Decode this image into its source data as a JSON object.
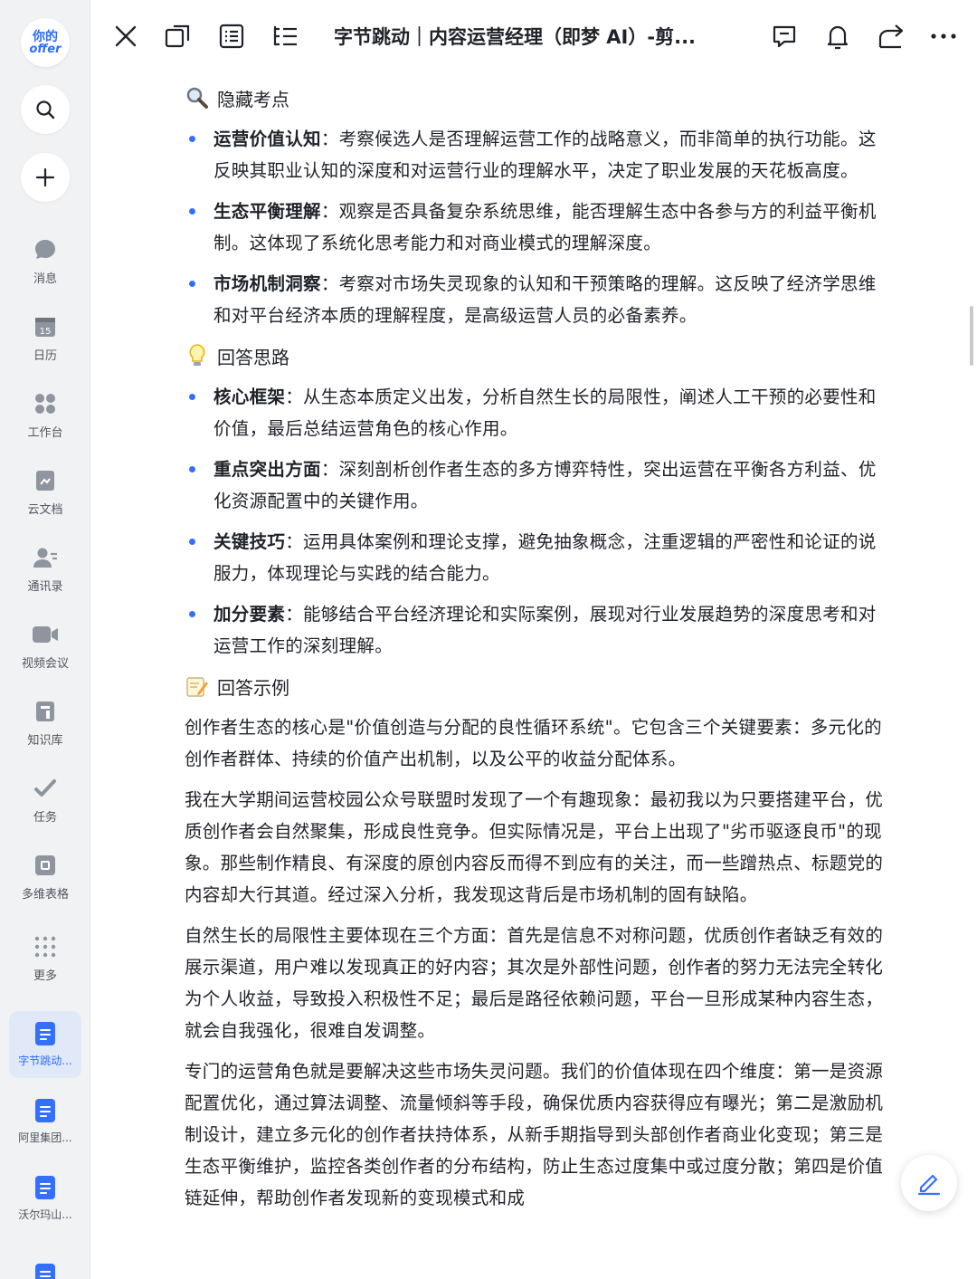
{
  "sidebar": {
    "logo_line1": "你的",
    "logo_line2": "offer",
    "search_icon": "search-icon",
    "add_icon": "plus-icon",
    "nav": [
      {
        "label": "消息",
        "icon": "chat-bubble-icon"
      },
      {
        "label": "日历",
        "icon": "calendar-icon",
        "day": "15"
      },
      {
        "label": "工作台",
        "icon": "apps-grid-icon"
      },
      {
        "label": "云文档",
        "icon": "cloud-doc-icon"
      },
      {
        "label": "通讯录",
        "icon": "contacts-icon"
      },
      {
        "label": "视频会议",
        "icon": "video-camera-icon"
      },
      {
        "label": "知识库",
        "icon": "knowledge-base-icon"
      },
      {
        "label": "任务",
        "icon": "task-check-icon"
      },
      {
        "label": "多维表格",
        "icon": "base-table-icon"
      },
      {
        "label": "更多",
        "icon": "more-dots-grid-icon"
      }
    ],
    "recent_docs": [
      {
        "label": "字节跳动...",
        "active": true
      },
      {
        "label": "阿里集团...",
        "active": false
      },
      {
        "label": "沃尔玛山...",
        "active": false
      },
      {
        "label": "",
        "active": false
      }
    ]
  },
  "topbar": {
    "title": "字节跳动｜内容运营经理（即梦 AI）-剪...",
    "icons": [
      "close-icon",
      "new-window-icon",
      "outline-icon",
      "list-icon",
      "comment-icon",
      "bell-icon",
      "share-icon",
      "more-icon"
    ]
  },
  "content": {
    "hidden_points": {
      "heading": "隐藏考点",
      "items": [
        {
          "title": "运营价值认知",
          "text": "：考察候选人是否理解运营工作的战略意义，而非简单的执行功能。这反映其职业认知的深度和对运营行业的理解水平，决定了职业发展的天花板高度。"
        },
        {
          "title": "生态平衡理解",
          "text": "：观察是否具备复杂系统思维，能否理解生态中各参与方的利益平衡机制。这体现了系统化思考能力和对商业模式的理解深度。"
        },
        {
          "title": "市场机制洞察",
          "text": "：考察对市场失灵现象的认知和干预策略的理解。这反映了经济学思维和对平台经济本质的理解程度，是高级运营人员的必备素养。"
        }
      ]
    },
    "answer_approach": {
      "heading": "回答思路",
      "items": [
        {
          "title": "核心框架",
          "text": "：从生态本质定义出发，分析自然生长的局限性，阐述人工干预的必要性和价值，最后总结运营角色的核心作用。"
        },
        {
          "title": "重点突出方面",
          "text": "：深刻剖析创作者生态的多方博弈特性，突出运营在平衡各方利益、优化资源配置中的关键作用。"
        },
        {
          "title": "关键技巧",
          "text": "：运用具体案例和理论支撑，避免抽象概念，注重逻辑的严密性和论证的说服力，体现理论与实践的结合能力。"
        },
        {
          "title": "加分要素",
          "text": "：能够结合平台经济理论和实际案例，展现对行业发展趋势的深度思考和对运营工作的深刻理解。"
        }
      ]
    },
    "answer_example": {
      "heading": "回答示例",
      "paragraphs": [
        "创作者生态的核心是\"价值创造与分配的良性循环系统\"。它包含三个关键要素：多元化的创作者群体、持续的价值产出机制，以及公平的收益分配体系。",
        "我在大学期间运营校园公众号联盟时发现了一个有趣现象：最初我以为只要搭建平台，优质创作者会自然聚集，形成良性竞争。但实际情况是，平台上出现了\"劣币驱逐良币\"的现象。那些制作精良、有深度的原创内容反而得不到应有的关注，而一些蹭热点、标题党的内容却大行其道。经过深入分析，我发现这背后是市场机制的固有缺陷。",
        "自然生长的局限性主要体现在三个方面：首先是信息不对称问题，优质创作者缺乏有效的展示渠道，用户难以发现真正的好内容；其次是外部性问题，创作者的努力无法完全转化为个人收益，导致投入积极性不足；最后是路径依赖问题，平台一旦形成某种内容生态，就会自我强化，很难自发调整。",
        "专门的运营角色就是要解决这些市场失灵问题。我们的价值体现在四个维度：第一是资源配置优化，通过算法调整、流量倾斜等手段，确保优质内容获得应有曝光；第二是激励机制设计，建立多元化的创作者扶持体系，从新手期指导到头部创作者商业化变现；第三是生态平衡维护，监控各类创作者的分布结构，防止生态过度集中或过度分散；第四是价值链延伸，帮助创作者发现新的变现模式和成"
      ]
    }
  },
  "fab": {
    "icon": "edit-pen-icon"
  },
  "colors": {
    "accent": "#3370ff",
    "sidebar_bg": "#f1f2f4",
    "text": "#1f2329"
  }
}
